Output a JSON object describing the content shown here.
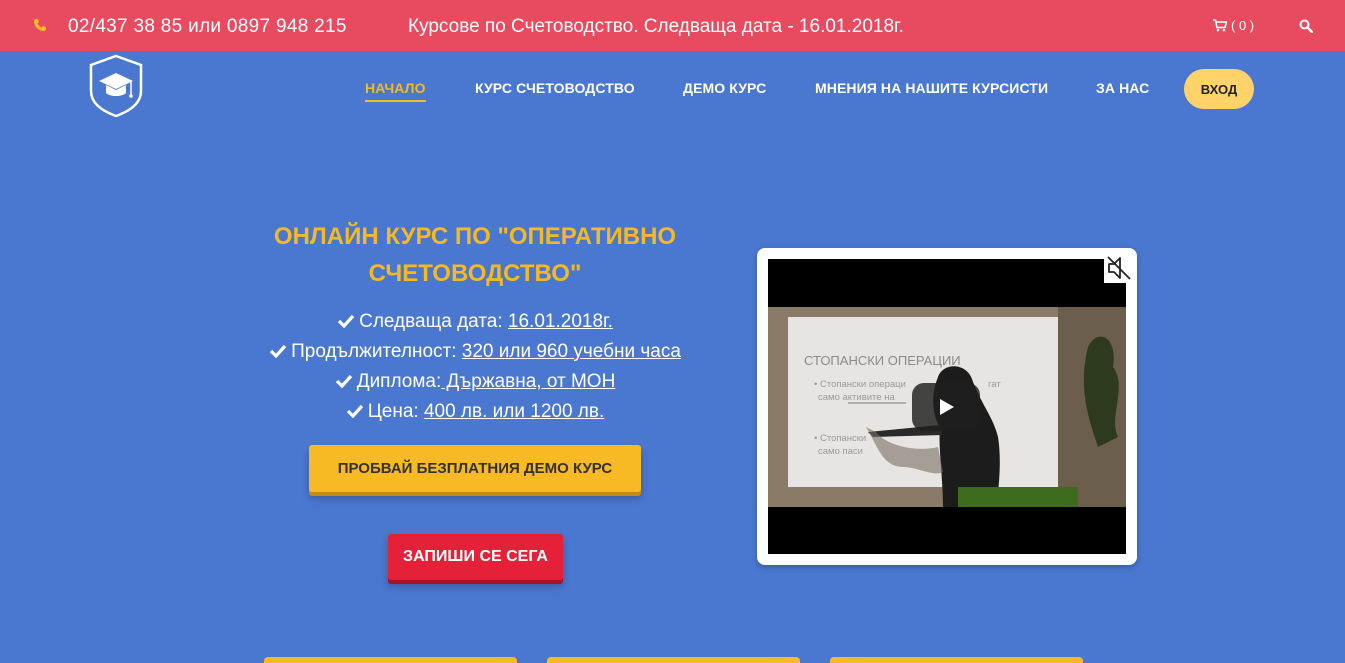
{
  "topbar": {
    "phone": "02/437 38 85 или 0897 948 215",
    "announcement": "Курсове по Счетоводство. Следваща дата - 16.01.2018г.",
    "cart_count": "( 0 )",
    "phone_icon": "phone-icon",
    "cart_icon": "cart-icon",
    "search_icon": "search-icon"
  },
  "nav": {
    "items": [
      {
        "label": "НАЧАЛО",
        "active": true
      },
      {
        "label": "КУРС СЧЕТОВОДСТВО"
      },
      {
        "label": "ДЕМО КУРС"
      },
      {
        "label": "МНЕНИЯ НА НАШИТЕ КУРСИСТИ"
      },
      {
        "label": "ЗА НАС"
      }
    ],
    "login": "ВХОД"
  },
  "hero": {
    "title": "ОНЛАЙН КУРС ПО \"ОПЕРАТИВНО СЧЕТОВОДСТВО\"",
    "features": [
      {
        "label": "Следваща дата: ",
        "value": "16.01.2018г."
      },
      {
        "label": "Продължителност: ",
        "value": "320 или 960 учебни часа"
      },
      {
        "label": "Диплома:",
        "value": " Държавна, от МОН"
      },
      {
        "label": "Цена: ",
        "value": "400 лв. или 1200 лв."
      }
    ],
    "demo_button": "ПРОБВАЙ БЕЗПЛАТНИЯ ДЕМО КУРС",
    "signup_button": "ЗАПИШИ СЕ СЕГА"
  },
  "video": {
    "slide_title": "СТОПАНСКИ ОПЕРАЦИИ",
    "slide_bullet_1a": "• Стопански операци",
    "slide_bullet_1b": "гат",
    "slide_bullet_1c": "само активите на",
    "slide_bullet_2a": "• Стопански",
    "slide_bullet_2b": "само паси",
    "mute_icon": "mute-icon",
    "play_icon": "play-icon"
  },
  "colors": {
    "background": "#4a77cf",
    "topbar": "#e84a5f",
    "accent_yellow": "#f5b921",
    "signup_red": "#e5213a"
  }
}
